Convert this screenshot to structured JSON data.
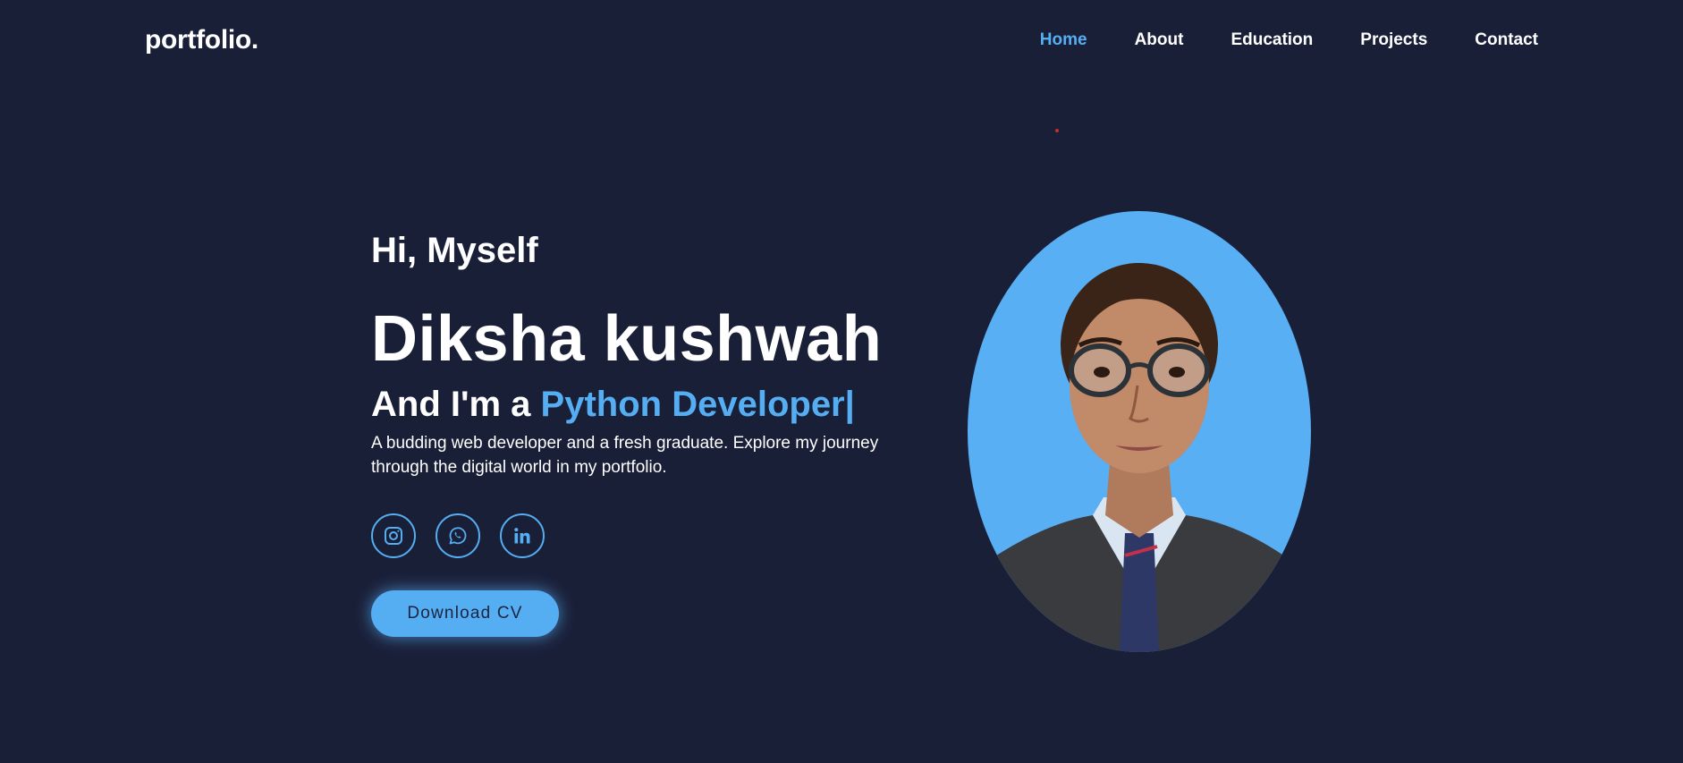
{
  "header": {
    "logo": "portfolio.",
    "nav": [
      {
        "label": "Home",
        "active": true
      },
      {
        "label": "About",
        "active": false
      },
      {
        "label": "Education",
        "active": false
      },
      {
        "label": "Projects",
        "active": false
      },
      {
        "label": "Contact",
        "active": false
      }
    ]
  },
  "hero": {
    "greeting": "Hi, Myself",
    "name": "Diksha kushwah",
    "role_prefix": "And I'm a",
    "role_highlight": "Python Developer|",
    "description": "A budding web developer and a fresh graduate. Explore my journey through the digital world in my portfolio.",
    "socials": [
      {
        "icon": "instagram-icon"
      },
      {
        "icon": "whatsapp-icon"
      },
      {
        "icon": "linkedin-icon"
      }
    ],
    "cta_label": "Download CV"
  },
  "colors": {
    "background": "#1a1f38",
    "accent": "#56aef2",
    "text": "#ffffff"
  }
}
